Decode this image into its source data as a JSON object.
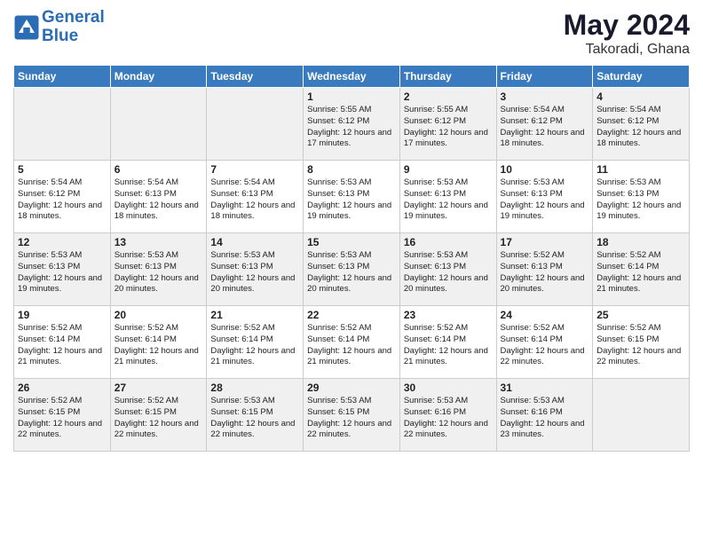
{
  "header": {
    "logo_line1": "General",
    "logo_line2": "Blue",
    "month_year": "May 2024",
    "location": "Takoradi, Ghana"
  },
  "days_of_week": [
    "Sunday",
    "Monday",
    "Tuesday",
    "Wednesday",
    "Thursday",
    "Friday",
    "Saturday"
  ],
  "weeks": [
    [
      {
        "day": "",
        "info": ""
      },
      {
        "day": "",
        "info": ""
      },
      {
        "day": "",
        "info": ""
      },
      {
        "day": "1",
        "info": "Sunrise: 5:55 AM\nSunset: 6:12 PM\nDaylight: 12 hours\nand 17 minutes."
      },
      {
        "day": "2",
        "info": "Sunrise: 5:55 AM\nSunset: 6:12 PM\nDaylight: 12 hours\nand 17 minutes."
      },
      {
        "day": "3",
        "info": "Sunrise: 5:54 AM\nSunset: 6:12 PM\nDaylight: 12 hours\nand 18 minutes."
      },
      {
        "day": "4",
        "info": "Sunrise: 5:54 AM\nSunset: 6:12 PM\nDaylight: 12 hours\nand 18 minutes."
      }
    ],
    [
      {
        "day": "5",
        "info": "Sunrise: 5:54 AM\nSunset: 6:12 PM\nDaylight: 12 hours\nand 18 minutes."
      },
      {
        "day": "6",
        "info": "Sunrise: 5:54 AM\nSunset: 6:13 PM\nDaylight: 12 hours\nand 18 minutes."
      },
      {
        "day": "7",
        "info": "Sunrise: 5:54 AM\nSunset: 6:13 PM\nDaylight: 12 hours\nand 18 minutes."
      },
      {
        "day": "8",
        "info": "Sunrise: 5:53 AM\nSunset: 6:13 PM\nDaylight: 12 hours\nand 19 minutes."
      },
      {
        "day": "9",
        "info": "Sunrise: 5:53 AM\nSunset: 6:13 PM\nDaylight: 12 hours\nand 19 minutes."
      },
      {
        "day": "10",
        "info": "Sunrise: 5:53 AM\nSunset: 6:13 PM\nDaylight: 12 hours\nand 19 minutes."
      },
      {
        "day": "11",
        "info": "Sunrise: 5:53 AM\nSunset: 6:13 PM\nDaylight: 12 hours\nand 19 minutes."
      }
    ],
    [
      {
        "day": "12",
        "info": "Sunrise: 5:53 AM\nSunset: 6:13 PM\nDaylight: 12 hours\nand 19 minutes."
      },
      {
        "day": "13",
        "info": "Sunrise: 5:53 AM\nSunset: 6:13 PM\nDaylight: 12 hours\nand 20 minutes."
      },
      {
        "day": "14",
        "info": "Sunrise: 5:53 AM\nSunset: 6:13 PM\nDaylight: 12 hours\nand 20 minutes."
      },
      {
        "day": "15",
        "info": "Sunrise: 5:53 AM\nSunset: 6:13 PM\nDaylight: 12 hours\nand 20 minutes."
      },
      {
        "day": "16",
        "info": "Sunrise: 5:53 AM\nSunset: 6:13 PM\nDaylight: 12 hours\nand 20 minutes."
      },
      {
        "day": "17",
        "info": "Sunrise: 5:52 AM\nSunset: 6:13 PM\nDaylight: 12 hours\nand 20 minutes."
      },
      {
        "day": "18",
        "info": "Sunrise: 5:52 AM\nSunset: 6:14 PM\nDaylight: 12 hours\nand 21 minutes."
      }
    ],
    [
      {
        "day": "19",
        "info": "Sunrise: 5:52 AM\nSunset: 6:14 PM\nDaylight: 12 hours\nand 21 minutes."
      },
      {
        "day": "20",
        "info": "Sunrise: 5:52 AM\nSunset: 6:14 PM\nDaylight: 12 hours\nand 21 minutes."
      },
      {
        "day": "21",
        "info": "Sunrise: 5:52 AM\nSunset: 6:14 PM\nDaylight: 12 hours\nand 21 minutes."
      },
      {
        "day": "22",
        "info": "Sunrise: 5:52 AM\nSunset: 6:14 PM\nDaylight: 12 hours\nand 21 minutes."
      },
      {
        "day": "23",
        "info": "Sunrise: 5:52 AM\nSunset: 6:14 PM\nDaylight: 12 hours\nand 21 minutes."
      },
      {
        "day": "24",
        "info": "Sunrise: 5:52 AM\nSunset: 6:14 PM\nDaylight: 12 hours\nand 22 minutes."
      },
      {
        "day": "25",
        "info": "Sunrise: 5:52 AM\nSunset: 6:15 PM\nDaylight: 12 hours\nand 22 minutes."
      }
    ],
    [
      {
        "day": "26",
        "info": "Sunrise: 5:52 AM\nSunset: 6:15 PM\nDaylight: 12 hours\nand 22 minutes."
      },
      {
        "day": "27",
        "info": "Sunrise: 5:52 AM\nSunset: 6:15 PM\nDaylight: 12 hours\nand 22 minutes."
      },
      {
        "day": "28",
        "info": "Sunrise: 5:53 AM\nSunset: 6:15 PM\nDaylight: 12 hours\nand 22 minutes."
      },
      {
        "day": "29",
        "info": "Sunrise: 5:53 AM\nSunset: 6:15 PM\nDaylight: 12 hours\nand 22 minutes."
      },
      {
        "day": "30",
        "info": "Sunrise: 5:53 AM\nSunset: 6:16 PM\nDaylight: 12 hours\nand 22 minutes."
      },
      {
        "day": "31",
        "info": "Sunrise: 5:53 AM\nSunset: 6:16 PM\nDaylight: 12 hours\nand 23 minutes."
      },
      {
        "day": "",
        "info": ""
      }
    ]
  ]
}
